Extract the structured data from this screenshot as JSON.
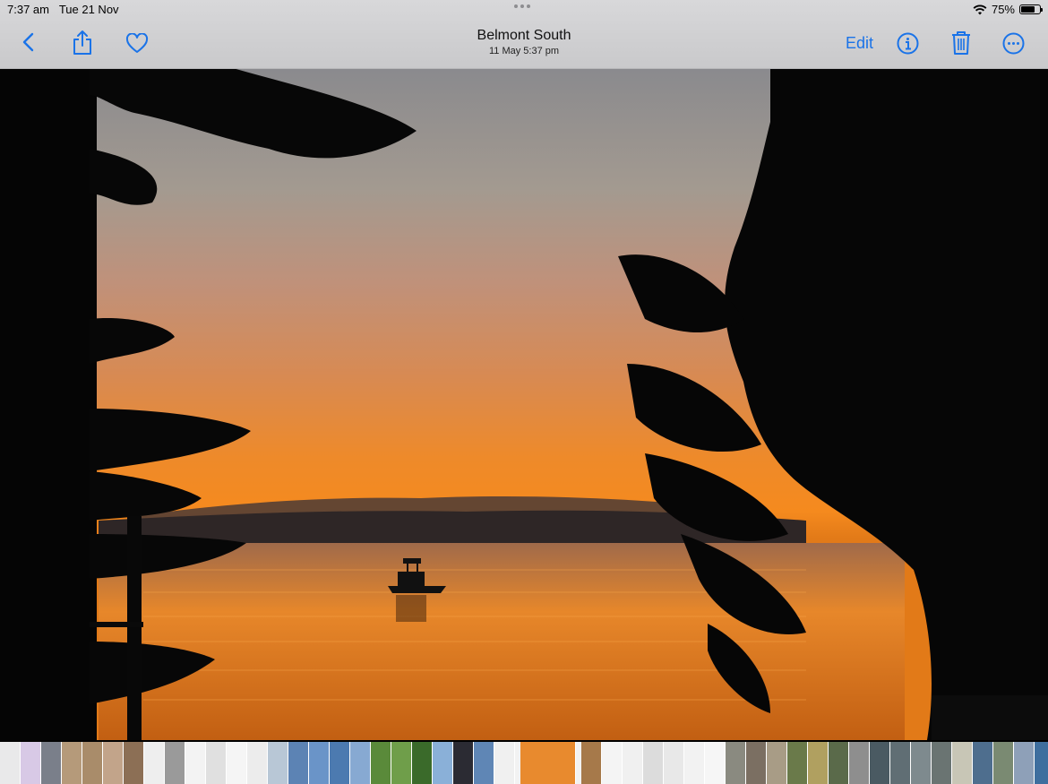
{
  "status_bar": {
    "time": "7:37 am",
    "date": "Tue 21 Nov",
    "battery_text": "75%",
    "battery_level": 0.75
  },
  "nav": {
    "title": "Belmont South",
    "subtitle": "11 May  5:37 pm",
    "edit_label": "Edit"
  },
  "icons": {
    "back": "chevron-left-icon",
    "share": "share-icon",
    "favorite": "heart-icon",
    "info": "info-icon",
    "delete": "trash-icon",
    "more": "ellipsis-circle-icon",
    "wifi": "wifi-icon",
    "battery": "battery-icon"
  },
  "colors": {
    "accent": "#1a73e8",
    "sky_top": "#8a8a8e",
    "sunset": "#f58a1e"
  },
  "filmstrip": {
    "thumbnails": [
      "#e9e9ea",
      "#d8c9e6",
      "#7a7f8a",
      "#b59a7a",
      "#a98c6a",
      "#c2a48a",
      "#8c6f55",
      "#eeeeee",
      "#9a9a9a",
      "#f3f3f3",
      "#e0e0e0",
      "#f5f5f5",
      "#ececec",
      "#b8c7d6",
      "#5c83b4",
      "#6a94c8",
      "#4c7ab0",
      "#87a9d2",
      "#5a8a3a",
      "#6f9e4a",
      "#3a6a2a",
      "#8ab0d8",
      "#2b2b33",
      "#5f86b5",
      "#f0f0f0",
      "#e88a2e",
      "#a6794a",
      "#f4f4f4",
      "#f0f0f0",
      "#dcdcdc",
      "#e8e8e8",
      "#f2f2f2",
      "#f6f6f6",
      "#8a8a80",
      "#7b6f62",
      "#a89c86",
      "#6a7a4a",
      "#b0a060",
      "#5a6a4a",
      "#8e8e8e",
      "#4a5a62",
      "#606e74",
      "#7e8a8e",
      "#6a7472",
      "#c8c6b6",
      "#4e6e8e",
      "#7a8a72",
      "#8ea0b8",
      "#3e6e9e",
      "#6f9fd0"
    ],
    "selected_index": 25
  }
}
